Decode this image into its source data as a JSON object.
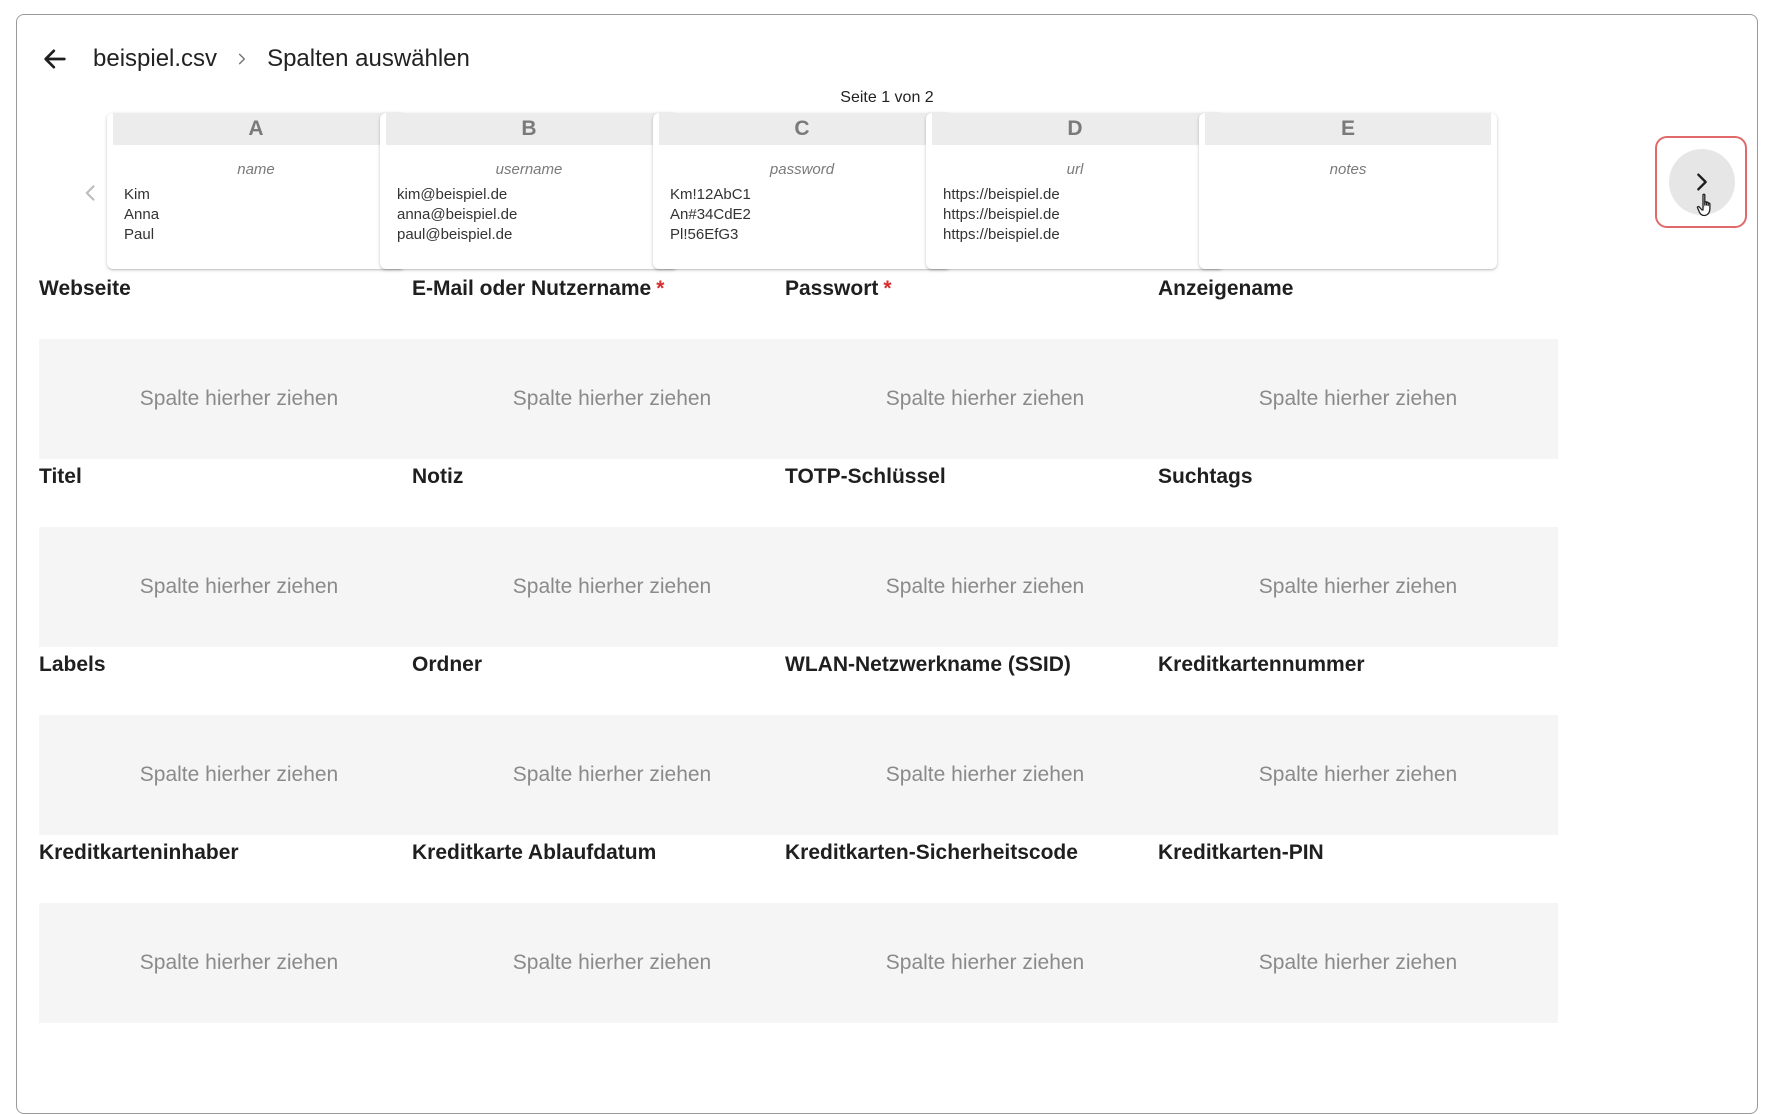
{
  "header": {
    "file_name": "beispiel.csv",
    "page_title": "Spalten auswählen"
  },
  "pagination": {
    "label": "Seite 1 von 2"
  },
  "columns": [
    {
      "letter": "A",
      "header": "name",
      "values": [
        "Kim",
        "Anna",
        "Paul"
      ]
    },
    {
      "letter": "B",
      "header": "username",
      "values": [
        "kim@beispiel.de",
        "anna@beispiel.de",
        "paul@beispiel.de"
      ]
    },
    {
      "letter": "C",
      "header": "password",
      "values": [
        "Km!12AbC1",
        "An#34CdE2",
        "Pl!56EfG3"
      ]
    },
    {
      "letter": "D",
      "header": "url",
      "values": [
        "https://beispiel.de",
        "https://beispiel.de",
        "https://beispiel.de"
      ]
    },
    {
      "letter": "E",
      "header": "notes",
      "values": []
    }
  ],
  "dropzone_text": "Spalte hierher ziehen",
  "fields": [
    {
      "label": "Webseite",
      "required": false
    },
    {
      "label": "E-Mail oder Nutzername",
      "required": true
    },
    {
      "label": "Passwort",
      "required": true
    },
    {
      "label": "Anzeigename",
      "required": false
    },
    {
      "label": "Titel",
      "required": false
    },
    {
      "label": "Notiz",
      "required": false
    },
    {
      "label": "TOTP-Schlüssel",
      "required": false
    },
    {
      "label": "Suchtags",
      "required": false
    },
    {
      "label": "Labels",
      "required": false
    },
    {
      "label": "Ordner",
      "required": false
    },
    {
      "label": "WLAN-Netzwerkname (SSID)",
      "required": false
    },
    {
      "label": "Kreditkartennummer",
      "required": false
    },
    {
      "label": "Kreditkarteninhaber",
      "required": false
    },
    {
      "label": "Kreditkarte Ablaufdatum",
      "required": false
    },
    {
      "label": "Kreditkarten-Sicherheitscode",
      "required": false
    },
    {
      "label": "Kreditkarten-PIN",
      "required": false
    }
  ],
  "required_marker": "*",
  "icons": {
    "back": "arrow-left-icon",
    "breadcrumb_separator": "chevron-right-icon",
    "prev": "chevron-left-icon",
    "next": "chevron-right-icon",
    "cursor": "hand-pointer-icon"
  },
  "colors": {
    "required": "#d32f2f",
    "highlight": "#e06a6a"
  }
}
